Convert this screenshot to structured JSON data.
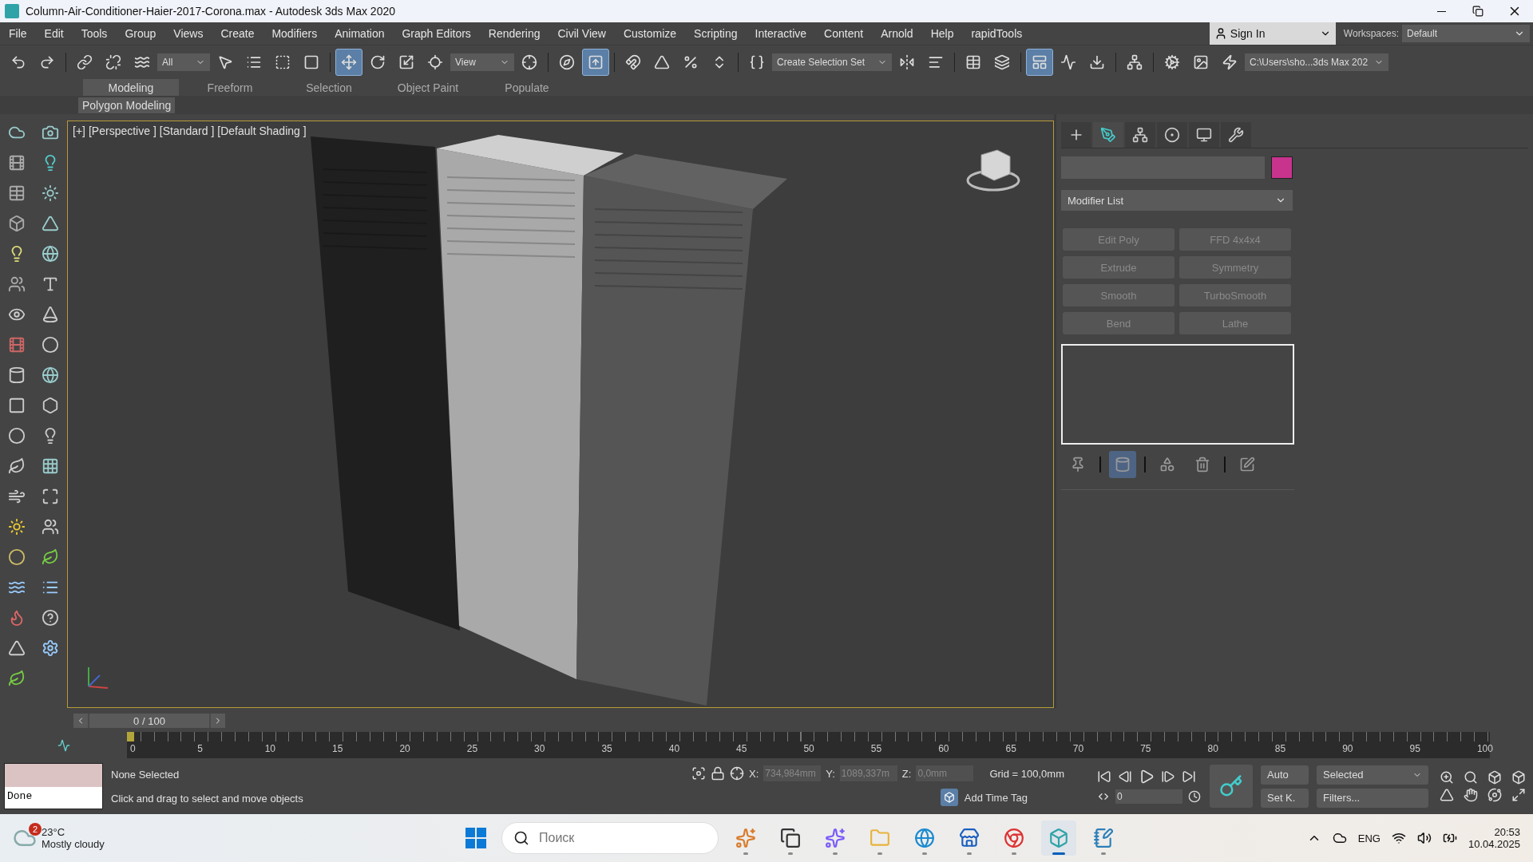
{
  "window": {
    "title": "Column-Air-Conditioner-Haier-2017-Corona.max - Autodesk 3ds Max 2020"
  },
  "menu": [
    "File",
    "Edit",
    "Tools",
    "Group",
    "Views",
    "Create",
    "Modifiers",
    "Animation",
    "Graph Editors",
    "Rendering",
    "Civil View",
    "Customize",
    "Scripting",
    "Interactive",
    "Content",
    "Arnold",
    "Help",
    "rapidTools"
  ],
  "account": {
    "sign_in": "Sign In",
    "workspaces_label": "Workspaces:",
    "workspace": "Default"
  },
  "toolbar": [
    {
      "kind": "tool",
      "selected": false
    },
    {
      "kind": "tool",
      "selected": false
    },
    {
      "kind": "separator"
    },
    {
      "kind": "tool",
      "selected": false
    },
    {
      "kind": "tool",
      "selected": false
    },
    {
      "kind": "tool",
      "selected": false
    },
    {
      "kind": "dropdown",
      "value": "All"
    },
    {
      "kind": "tool",
      "selected": false
    },
    {
      "kind": "tool",
      "selected": false
    },
    {
      "kind": "tool",
      "selected": false
    },
    {
      "kind": "tool",
      "selected": false
    },
    {
      "kind": "separator"
    },
    {
      "kind": "tool",
      "selected": true
    },
    {
      "kind": "tool",
      "selected": false
    },
    {
      "kind": "tool",
      "selected": false
    },
    {
      "kind": "tool",
      "selected": false
    },
    {
      "kind": "dropdown",
      "value": "View"
    },
    {
      "kind": "tool",
      "selected": false
    },
    {
      "kind": "separator"
    },
    {
      "kind": "tool",
      "selected": false
    },
    {
      "kind": "tool",
      "selected": true
    },
    {
      "kind": "separator"
    },
    {
      "kind": "tool",
      "selected": false
    },
    {
      "kind": "tool",
      "selected": false
    },
    {
      "kind": "tool",
      "selected": false
    },
    {
      "kind": "tool",
      "selected": false
    },
    {
      "kind": "separator"
    },
    {
      "kind": "tool",
      "selected": false
    },
    {
      "kind": "dropdown",
      "value": "Create Selection Set"
    },
    {
      "kind": "tool",
      "selected": false
    },
    {
      "kind": "tool",
      "selected": false
    },
    {
      "kind": "separator"
    },
    {
      "kind": "tool",
      "selected": false
    },
    {
      "kind": "tool",
      "selected": false
    },
    {
      "kind": "separator"
    },
    {
      "kind": "tool",
      "selected": true
    },
    {
      "kind": "tool",
      "selected": false
    },
    {
      "kind": "tool",
      "selected": false
    },
    {
      "kind": "separator"
    },
    {
      "kind": "tool",
      "selected": false
    },
    {
      "kind": "separator"
    },
    {
      "kind": "tool",
      "selected": false
    },
    {
      "kind": "tool",
      "selected": false
    },
    {
      "kind": "tool",
      "selected": false
    },
    {
      "kind": "dropdown",
      "value": "C:\\Users\\sho...3ds Max 202"
    }
  ],
  "ribbon": {
    "tabs": [
      {
        "label": "Modeling",
        "selected": true
      },
      {
        "label": "Freeform",
        "selected": false
      },
      {
        "label": "Selection",
        "selected": false
      },
      {
        "label": "Object Paint",
        "selected": false
      },
      {
        "label": "Populate",
        "selected": false
      }
    ],
    "panel": "Polygon Modeling"
  },
  "viewport": {
    "labels": [
      "[+]",
      "[Perspective ]",
      "[Standard ]",
      "[Default Shading ]"
    ]
  },
  "command_panel": {
    "tabs": [
      {
        "selected": false
      },
      {
        "selected": true
      },
      {
        "selected": false
      },
      {
        "selected": false
      },
      {
        "selected": false
      },
      {
        "selected": false
      }
    ],
    "modifier_list": "Modifier List",
    "modifier_buttons": [
      {
        "label": "Edit Poly",
        "disabled": true
      },
      {
        "label": "FFD 4x4x4",
        "disabled": true
      },
      {
        "label": "Extrude",
        "disabled": true
      },
      {
        "label": "Symmetry",
        "disabled": true
      },
      {
        "label": "Smooth",
        "disabled": true
      },
      {
        "label": "TurboSmooth",
        "disabled": true
      },
      {
        "label": "Bend",
        "disabled": true
      },
      {
        "label": "Lathe",
        "disabled": true
      }
    ],
    "stack_tools": [
      {
        "selected": false
      },
      {
        "selected": true
      },
      {
        "selected": false
      },
      {
        "selected": false
      },
      {
        "selected": false
      }
    ]
  },
  "timeline": {
    "frame": "0 / 100",
    "level": 0,
    "ticks": [
      "0",
      "5",
      "10",
      "15",
      "20",
      "25",
      "30",
      "35",
      "40",
      "45",
      "50",
      "55",
      "60",
      "65",
      "70",
      "75",
      "80",
      "85",
      "90",
      "95",
      "100"
    ]
  },
  "status_bar": {
    "maxscript_output": "Done",
    "selection": "None Selected",
    "prompt": "Click and drag to select and move objects",
    "x_label": "X:",
    "x": "734,984mm",
    "y_label": "Y:",
    "y": "1089,337m",
    "z_label": "Z:",
    "z": "0,0mm",
    "grid": "Grid = 100,0mm",
    "time_tag": "Add Time Tag",
    "frame": "0",
    "auto_key": "Auto",
    "set_key": "Set K.",
    "key_filter": "Selected",
    "filters": "Filters..."
  },
  "taskbar": {
    "weather_badge": "2",
    "temperature": "23°C",
    "weather": "Mostly cloudy",
    "search": {
      "placeholder": "Поиск"
    },
    "apps": [
      {
        "selected": false
      },
      {
        "selected": false
      },
      {
        "selected": false
      },
      {
        "selected": false
      },
      {
        "selected": false
      },
      {
        "selected": false
      },
      {
        "selected": false
      },
      {
        "selected": true
      },
      {
        "selected": false
      }
    ],
    "language": "ENG",
    "time": "20:53",
    "date": "10.04.2025"
  }
}
